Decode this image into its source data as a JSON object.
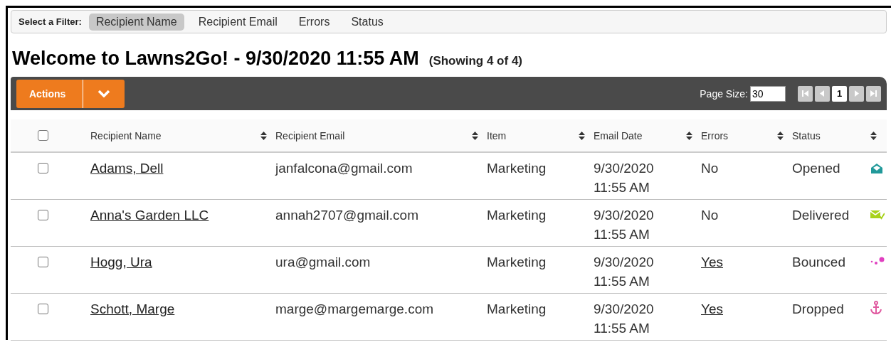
{
  "filter_bar": {
    "label": "Select a Filter:",
    "filters": [
      {
        "label": "Recipient Name",
        "selected": true
      },
      {
        "label": "Recipient Email",
        "selected": false
      },
      {
        "label": "Errors",
        "selected": false
      },
      {
        "label": "Status",
        "selected": false
      }
    ]
  },
  "title": "Welcome to Lawns2Go! - 9/30/2020 11:55 AM",
  "showing": "(Showing 4 of 4)",
  "toolbar": {
    "actions": "Actions",
    "page_size_label": "Page Size:",
    "page_size": "30",
    "page": "1"
  },
  "table": {
    "select_all": {
      "checked": false
    },
    "columns": [
      "Recipient Name",
      "Recipient Email",
      "Item",
      "Email Date",
      "Errors",
      "Status"
    ],
    "rows": [
      {
        "checked": false,
        "name": "Adams, Dell",
        "email": "janfalcona@gmail.com",
        "item": "Marketing",
        "date": "9/30/2020",
        "time": "11:55 AM",
        "errors": {
          "kind": "text",
          "text": "No"
        },
        "status": "Opened",
        "status_icon": {
          "kind": "opened"
        }
      },
      {
        "checked": false,
        "name": "Anna's Garden LLC",
        "email": "annah2707@gmail.com",
        "item": "Marketing",
        "date": "9/30/2020",
        "time": "11:55 AM",
        "errors": {
          "kind": "text",
          "text": "No"
        },
        "status": "Delivered",
        "status_icon": {
          "kind": "delivered"
        }
      },
      {
        "checked": false,
        "name": "Hogg, Ura",
        "email": "ura@gmail.com",
        "item": "Marketing",
        "date": "9/30/2020",
        "time": "11:55 AM",
        "errors": {
          "kind": "link",
          "text": "Yes"
        },
        "status": "Bounced",
        "status_icon": {
          "kind": "bounced"
        }
      },
      {
        "checked": false,
        "name": "Schott, Marge",
        "email": "marge@margemarge.com",
        "item": "Marketing",
        "date": "9/30/2020",
        "time": "11:55 AM",
        "errors": {
          "kind": "link",
          "text": "Yes"
        },
        "status": "Dropped",
        "status_icon": {
          "kind": "dropped"
        }
      }
    ]
  }
}
